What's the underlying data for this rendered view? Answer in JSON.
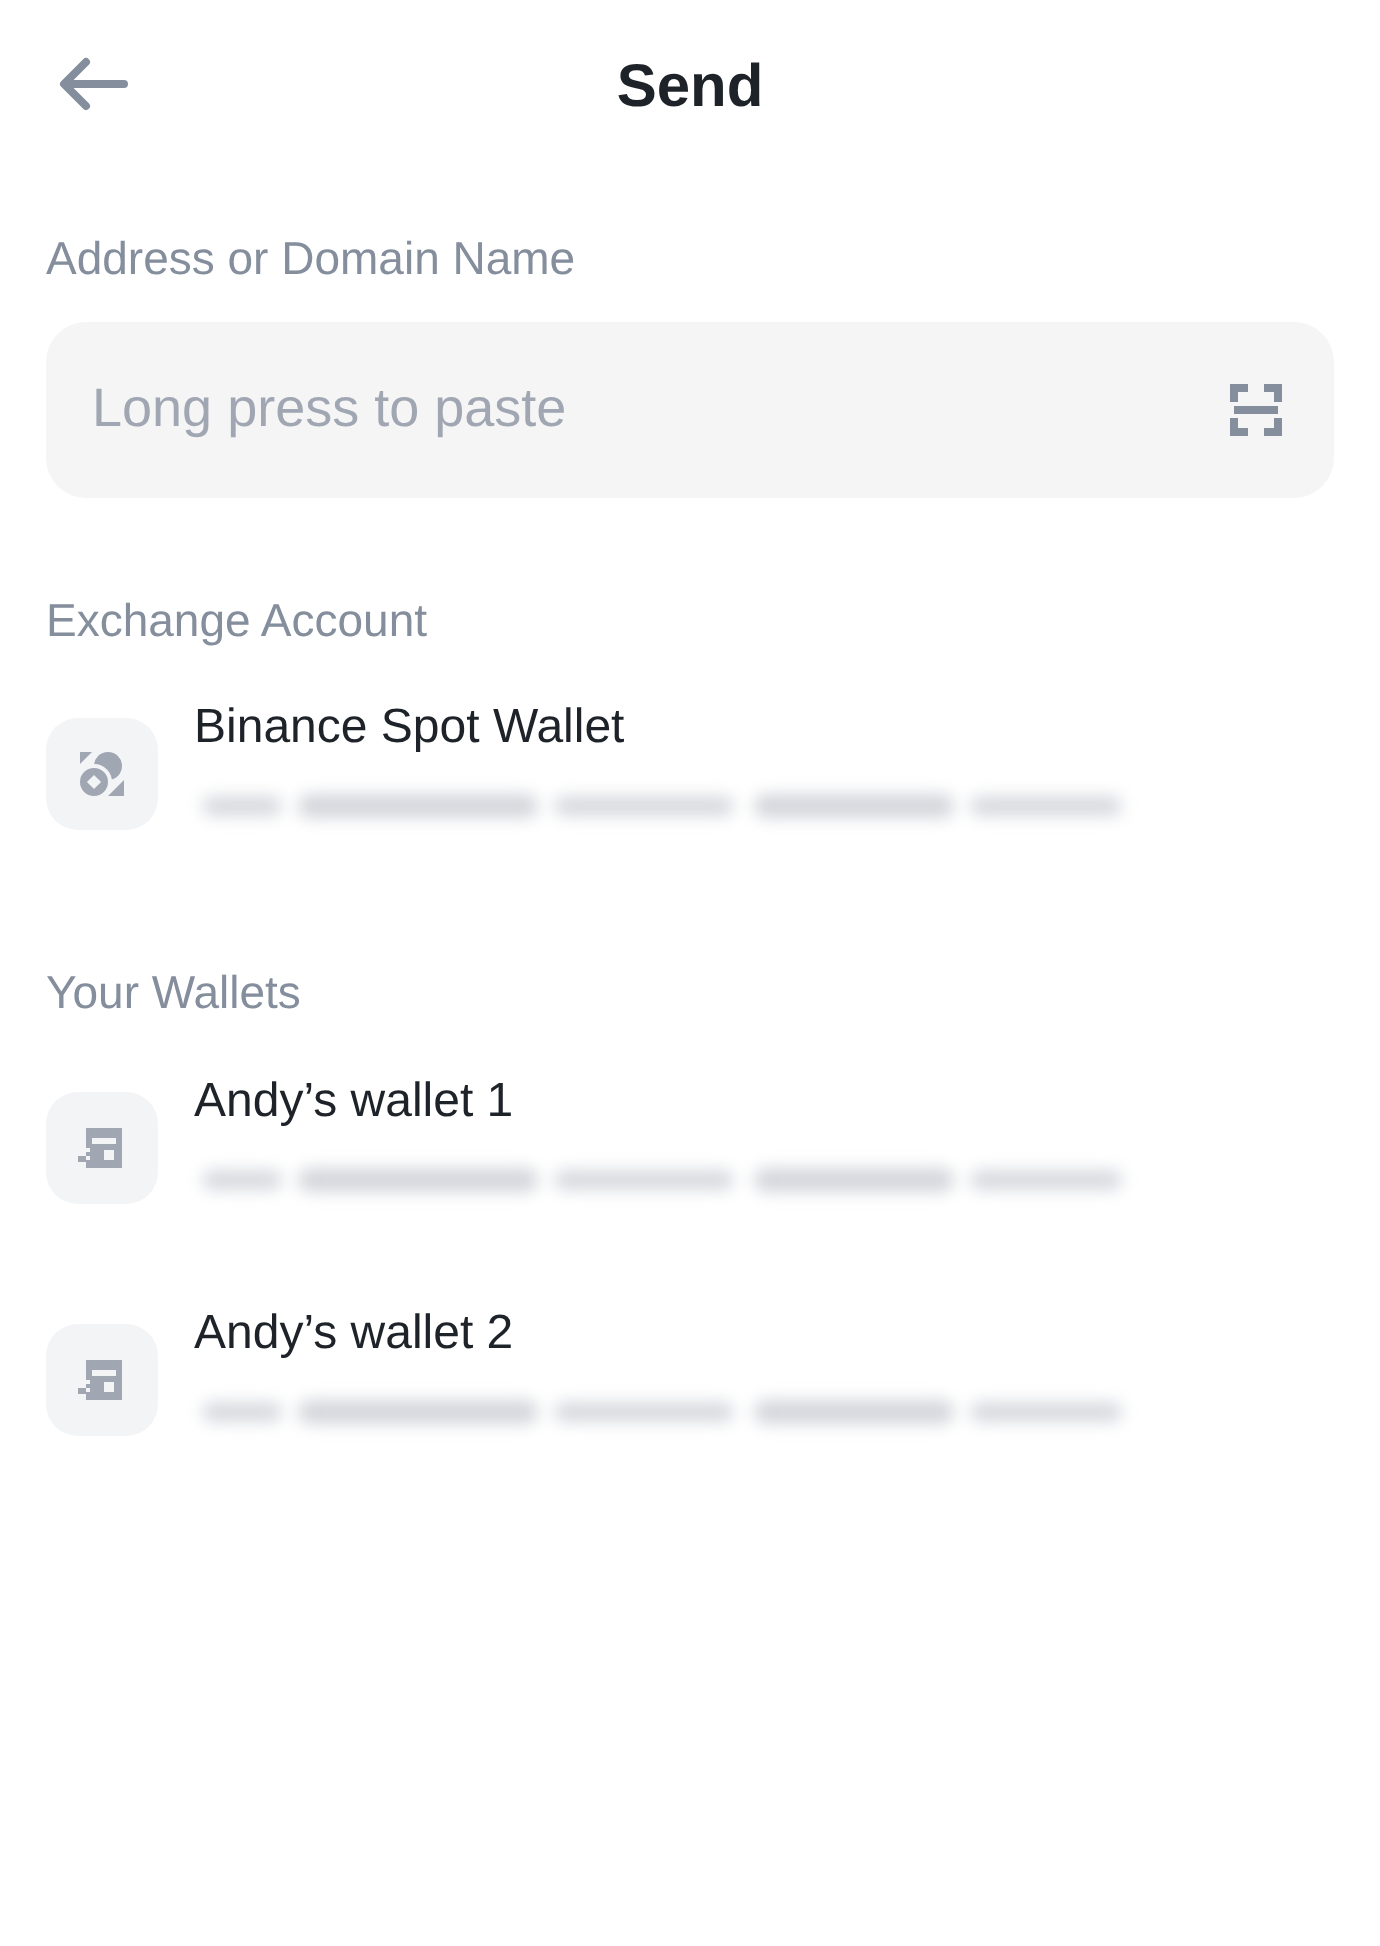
{
  "header": {
    "title": "Send"
  },
  "address": {
    "label": "Address or Domain Name",
    "placeholder": "Long press to paste"
  },
  "sections": [
    {
      "title": "Exchange Account",
      "items": [
        {
          "kind": "exchange",
          "name": "Binance Spot Wallet"
        }
      ]
    },
    {
      "title": "Your Wallets",
      "items": [
        {
          "kind": "wallet",
          "name": "Andy’s wallet 1"
        },
        {
          "kind": "wallet",
          "name": "Andy’s wallet 2"
        }
      ]
    }
  ]
}
